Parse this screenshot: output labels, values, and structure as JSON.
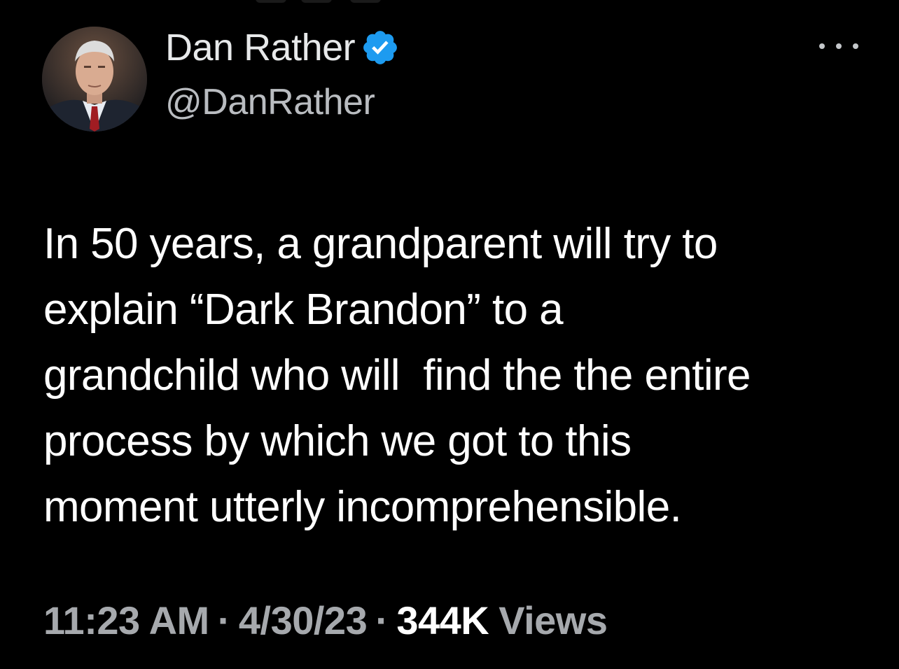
{
  "tweet": {
    "author": {
      "display_name": "Dan Rather",
      "handle": "@DanRather",
      "verified_icon": "verified-badge-icon",
      "verified_color": "#1d9bf0"
    },
    "more_icon": "more-horizontal-icon",
    "text_lines": [
      "In 50 years, a grandparent will try to",
      "explain “Dark Brandon” to a",
      "grandchild who will  find the the entire",
      "process by which we got to this",
      "moment utterly incomprehensible."
    ],
    "meta": {
      "time": "11:23 AM",
      "separator": "·",
      "date": "4/30/23",
      "views_count": "344K",
      "views_label": "Views"
    }
  }
}
